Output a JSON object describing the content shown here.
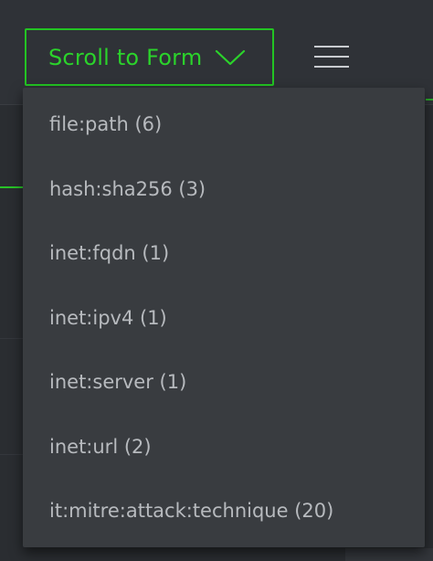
{
  "toolbar": {
    "scroll_button_label": "Scroll to Form",
    "scroll_button_icon": "chevron-down-icon",
    "menu_icon": "hamburger-menu-icon"
  },
  "dropdown": {
    "items": [
      {
        "label": "file:path (6)"
      },
      {
        "label": "hash:sha256 (3)"
      },
      {
        "label": "inet:fqdn (1)"
      },
      {
        "label": "inet:ipv4 (1)"
      },
      {
        "label": "inet:server (1)"
      },
      {
        "label": "inet:url (2)"
      },
      {
        "label": "it:mitre:attack:technique (20)"
      }
    ]
  },
  "colors": {
    "accent": "#23c423",
    "background": "#2c2f33",
    "dropdown_bg": "#393c40",
    "item_text": "#b7babe"
  }
}
